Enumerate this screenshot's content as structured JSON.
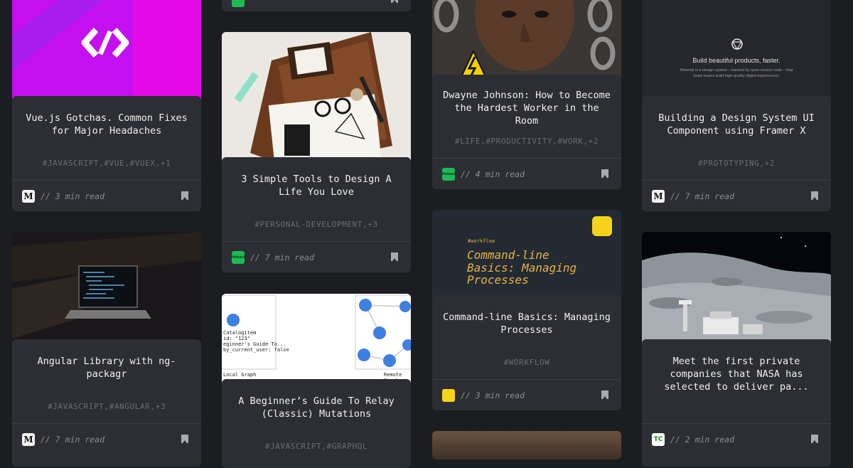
{
  "cards": [
    {
      "title": "Vue.js Gotchas. Common Fixes for Major Headaches",
      "tags": "#JAVASCRIPT,#VUE,#VUEX,+1",
      "read": "// 3 min read",
      "source": "M"
    },
    {
      "title": "Angular Library with ng-packagr",
      "tags": "#JAVASCRIPT,#ANGULAR,+3",
      "read": "// 7 min read",
      "source": "M"
    },
    {
      "title": "3 Simple Tools to Design A Life You Love",
      "tags": "#PERSONAL-DEVELOPMENT,+3",
      "read": "// 7 min read",
      "source": "lifehack"
    },
    {
      "title": "A Beginner’s Guide To Relay (Classic) Mutations",
      "tags": "#JAVASCRIPT,#GRAPHQL",
      "read": "",
      "source": ""
    },
    {
      "title": "Dwayne Johnson: How to Become the Hardest Worker in the Room",
      "tags": "#LIFE,#PRODUCTIVITY,#WORK,+2",
      "read": "// 4 min read",
      "source": "lifehack"
    },
    {
      "title": "Command-line Basics: Managing Processes",
      "tags": "#WORKFLOW",
      "read": "// 3 min read",
      "source": "workflow"
    },
    {
      "title": "Building a Design System UI Component using Framer X",
      "tags": "#PROTOTYPING,+2",
      "read": "// 7 min read",
      "source": "M"
    },
    {
      "title": "Meet the first private companies that NASA has selected to deliver pa...",
      "tags": "",
      "read": "// 2 min read",
      "source": "TC"
    }
  ],
  "media": {
    "material_heading": "Build beautiful products, faster.",
    "material_sub": "Material is a design system – backed by open-source code – that helps teams build high-quality digital experiences.",
    "workflow_tag": "#workflow",
    "workflow_line1": "Command-line",
    "workflow_line2": "Basics: Managing",
    "workflow_line3": "Processes",
    "relay_label1": "Catalogitem",
    "relay_label2": "id: \"123\"",
    "relay_label3": "eginner's Guide To...",
    "relay_label4": "by_current_user: false",
    "relay_local": "Local Graph",
    "relay_remote": "Remote Graph",
    "lifehack_badge": "lifehack"
  },
  "colors": {
    "background": "#1c1d21",
    "card": "#2d2e33",
    "vue_magenta": "#d10af0",
    "workflow_yellow": "#e7b341",
    "lifehack_green": "#1db954"
  }
}
